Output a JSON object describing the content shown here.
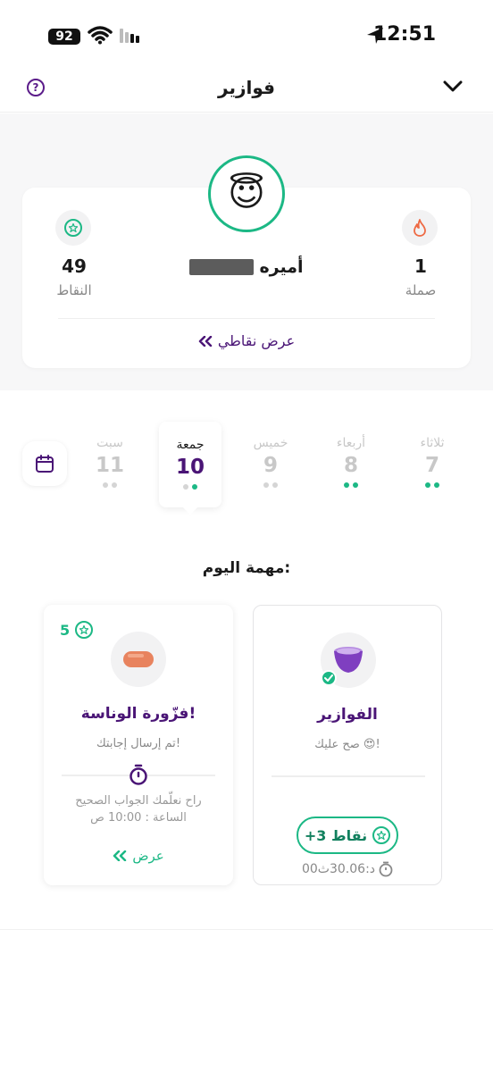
{
  "status_bar": {
    "battery": "92",
    "time": "12:51"
  },
  "header": {
    "title": "فوازير"
  },
  "profile": {
    "avatar_emoji": "😇",
    "streak_value": "1",
    "streak_label": "صملة",
    "user_name": "أميره",
    "points_value": "49",
    "points_label": "النقاط",
    "view_points_label": "عرض نقاطي"
  },
  "days": [
    {
      "name": "ثلاثاء",
      "number": "7",
      "state": "done"
    },
    {
      "name": "أربعاء",
      "number": "8",
      "state": "done"
    },
    {
      "name": "خميس",
      "number": "9",
      "state": "missed"
    },
    {
      "name": "جمعة",
      "number": "10",
      "state": "active"
    },
    {
      "name": "سبت",
      "number": "11",
      "state": "future"
    }
  ],
  "tasks_title": "مهمة اليوم:",
  "tasks": {
    "riddle": {
      "name": "فزّورة الوناسة!",
      "points": "5",
      "status": "تم إرسال إجابتك!",
      "reveal_line1": "راح نعلّمك الجواب الصحيح",
      "reveal_line2": "الساعة : 10:00 ص",
      "view_label": "عرض"
    },
    "fawazir": {
      "name": "الفوازير",
      "status": "صح عليك 😍!",
      "points_badge": "+3 نقاط",
      "timer": "00د:30.06ث"
    }
  },
  "colors": {
    "accent_green": "#1cb885",
    "brand_purple": "#4a1576"
  }
}
